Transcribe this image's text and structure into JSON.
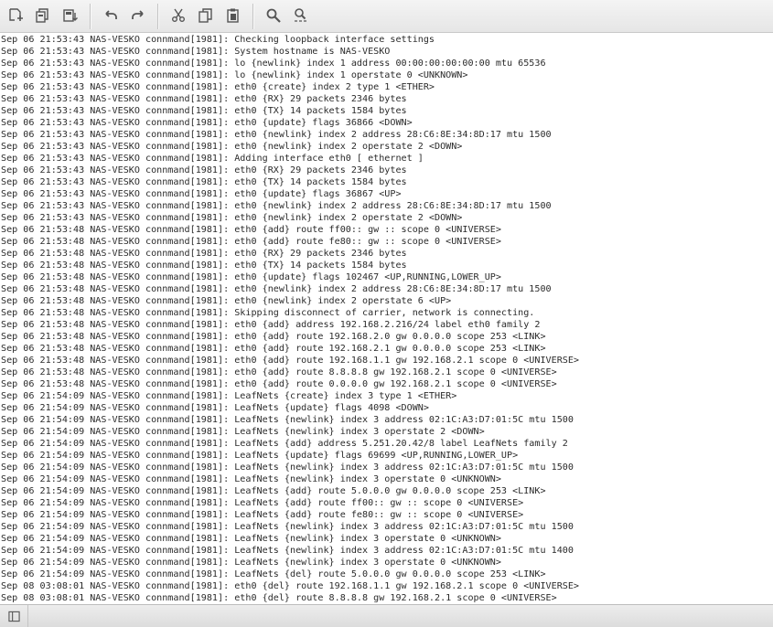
{
  "toolbar": {
    "buttons": [
      {
        "icon": "open-file-icon"
      },
      {
        "icon": "copy-document-icon"
      },
      {
        "icon": "save-document-icon"
      },
      {
        "icon": "undo-icon"
      },
      {
        "icon": "redo-icon"
      },
      {
        "icon": "cut-icon"
      },
      {
        "icon": "copy-icon"
      },
      {
        "icon": "paste-icon"
      },
      {
        "icon": "search-icon"
      },
      {
        "icon": "search-replace-icon"
      }
    ]
  },
  "log": {
    "lines": [
      "Sep 06 21:53:43 NAS-VESKO connmand[1981]: Checking loopback interface settings",
      "Sep 06 21:53:43 NAS-VESKO connmand[1981]: System hostname is NAS-VESKO",
      "Sep 06 21:53:43 NAS-VESKO connmand[1981]: lo {newlink} index 1 address 00:00:00:00:00:00 mtu 65536",
      "Sep 06 21:53:43 NAS-VESKO connmand[1981]: lo {newlink} index 1 operstate 0 <UNKNOWN>",
      "Sep 06 21:53:43 NAS-VESKO connmand[1981]: eth0 {create} index 2 type 1 <ETHER>",
      "Sep 06 21:53:43 NAS-VESKO connmand[1981]: eth0 {RX} 29 packets 2346 bytes",
      "Sep 06 21:53:43 NAS-VESKO connmand[1981]: eth0 {TX} 14 packets 1584 bytes",
      "Sep 06 21:53:43 NAS-VESKO connmand[1981]: eth0 {update} flags 36866 <DOWN>",
      "Sep 06 21:53:43 NAS-VESKO connmand[1981]: eth0 {newlink} index 2 address 28:C6:8E:34:8D:17 mtu 1500",
      "Sep 06 21:53:43 NAS-VESKO connmand[1981]: eth0 {newlink} index 2 operstate 2 <DOWN>",
      "Sep 06 21:53:43 NAS-VESKO connmand[1981]: Adding interface eth0 [ ethernet ]",
      "Sep 06 21:53:43 NAS-VESKO connmand[1981]: eth0 {RX} 29 packets 2346 bytes",
      "Sep 06 21:53:43 NAS-VESKO connmand[1981]: eth0 {TX} 14 packets 1584 bytes",
      "Sep 06 21:53:43 NAS-VESKO connmand[1981]: eth0 {update} flags 36867 <UP>",
      "Sep 06 21:53:43 NAS-VESKO connmand[1981]: eth0 {newlink} index 2 address 28:C6:8E:34:8D:17 mtu 1500",
      "Sep 06 21:53:43 NAS-VESKO connmand[1981]: eth0 {newlink} index 2 operstate 2 <DOWN>",
      "Sep 06 21:53:48 NAS-VESKO connmand[1981]: eth0 {add} route ff00:: gw :: scope 0 <UNIVERSE>",
      "Sep 06 21:53:48 NAS-VESKO connmand[1981]: eth0 {add} route fe80:: gw :: scope 0 <UNIVERSE>",
      "Sep 06 21:53:48 NAS-VESKO connmand[1981]: eth0 {RX} 29 packets 2346 bytes",
      "Sep 06 21:53:48 NAS-VESKO connmand[1981]: eth0 {TX} 14 packets 1584 bytes",
      "Sep 06 21:53:48 NAS-VESKO connmand[1981]: eth0 {update} flags 102467 <UP,RUNNING,LOWER_UP>",
      "Sep 06 21:53:48 NAS-VESKO connmand[1981]: eth0 {newlink} index 2 address 28:C6:8E:34:8D:17 mtu 1500",
      "Sep 06 21:53:48 NAS-VESKO connmand[1981]: eth0 {newlink} index 2 operstate 6 <UP>",
      "Sep 06 21:53:48 NAS-VESKO connmand[1981]: Skipping disconnect of carrier, network is connecting.",
      "Sep 06 21:53:48 NAS-VESKO connmand[1981]: eth0 {add} address 192.168.2.216/24 label eth0 family 2",
      "Sep 06 21:53:48 NAS-VESKO connmand[1981]: eth0 {add} route 192.168.2.0 gw 0.0.0.0 scope 253 <LINK>",
      "Sep 06 21:53:48 NAS-VESKO connmand[1981]: eth0 {add} route 192.168.2.1 gw 0.0.0.0 scope 253 <LINK>",
      "Sep 06 21:53:48 NAS-VESKO connmand[1981]: eth0 {add} route 192.168.1.1 gw 192.168.2.1 scope 0 <UNIVERSE>",
      "Sep 06 21:53:48 NAS-VESKO connmand[1981]: eth0 {add} route 8.8.8.8 gw 192.168.2.1 scope 0 <UNIVERSE>",
      "Sep 06 21:53:48 NAS-VESKO connmand[1981]: eth0 {add} route 0.0.0.0 gw 192.168.2.1 scope 0 <UNIVERSE>",
      "Sep 06 21:54:09 NAS-VESKO connmand[1981]: LeafNets {create} index 3 type 1 <ETHER>",
      "Sep 06 21:54:09 NAS-VESKO connmand[1981]: LeafNets {update} flags 4098 <DOWN>",
      "Sep 06 21:54:09 NAS-VESKO connmand[1981]: LeafNets {newlink} index 3 address 02:1C:A3:D7:01:5C mtu 1500",
      "Sep 06 21:54:09 NAS-VESKO connmand[1981]: LeafNets {newlink} index 3 operstate 2 <DOWN>",
      "Sep 06 21:54:09 NAS-VESKO connmand[1981]: LeafNets {add} address 5.251.20.42/8 label LeafNets family 2",
      "Sep 06 21:54:09 NAS-VESKO connmand[1981]: LeafNets {update} flags 69699 <UP,RUNNING,LOWER_UP>",
      "Sep 06 21:54:09 NAS-VESKO connmand[1981]: LeafNets {newlink} index 3 address 02:1C:A3:D7:01:5C mtu 1500",
      "Sep 06 21:54:09 NAS-VESKO connmand[1981]: LeafNets {newlink} index 3 operstate 0 <UNKNOWN>",
      "Sep 06 21:54:09 NAS-VESKO connmand[1981]: LeafNets {add} route 5.0.0.0 gw 0.0.0.0 scope 253 <LINK>",
      "Sep 06 21:54:09 NAS-VESKO connmand[1981]: LeafNets {add} route ff00:: gw :: scope 0 <UNIVERSE>",
      "Sep 06 21:54:09 NAS-VESKO connmand[1981]: LeafNets {add} route fe80:: gw :: scope 0 <UNIVERSE>",
      "Sep 06 21:54:09 NAS-VESKO connmand[1981]: LeafNets {newlink} index 3 address 02:1C:A3:D7:01:5C mtu 1500",
      "Sep 06 21:54:09 NAS-VESKO connmand[1981]: LeafNets {newlink} index 3 operstate 0 <UNKNOWN>",
      "Sep 06 21:54:09 NAS-VESKO connmand[1981]: LeafNets {newlink} index 3 address 02:1C:A3:D7:01:5C mtu 1400",
      "Sep 06 21:54:09 NAS-VESKO connmand[1981]: LeafNets {newlink} index 3 operstate 0 <UNKNOWN>",
      "Sep 06 21:54:09 NAS-VESKO connmand[1981]: LeafNets {del} route 5.0.0.0 gw 0.0.0.0 scope 253 <LINK>",
      "Sep 08 03:08:01 NAS-VESKO connmand[1981]: eth0 {del} route 192.168.1.1 gw 192.168.2.1 scope 0 <UNIVERSE>",
      "Sep 08 03:08:01 NAS-VESKO connmand[1981]: eth0 {del} route 8.8.8.8 gw 192.168.2.1 scope 0 <UNIVERSE>"
    ]
  },
  "statusbar": {
    "toggle_icon": "side-panel-icon"
  },
  "colors": {
    "text": "#2b2b2b",
    "icon": "#555555",
    "toolbar_bg": "#ececec"
  }
}
